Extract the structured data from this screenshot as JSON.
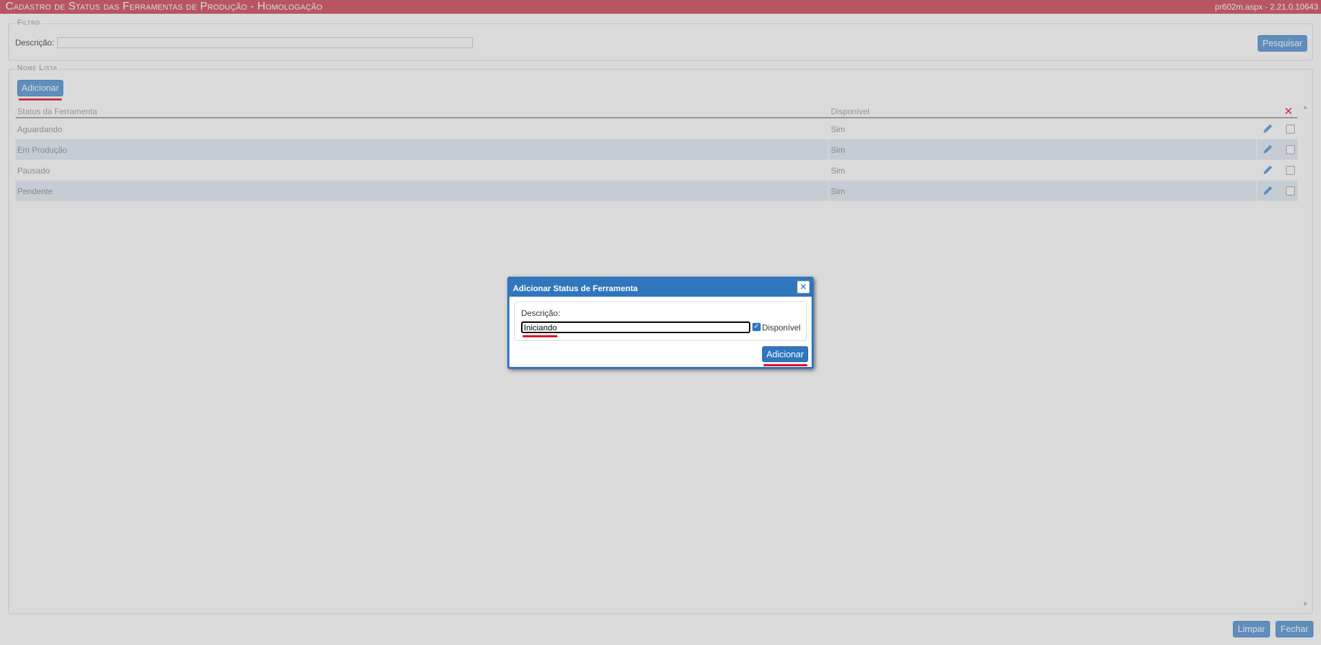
{
  "header": {
    "title": "Cadastro de Status das Ferramentas de Produção  - Homologação",
    "version": "pr602m.aspx - 2.21.0.10643"
  },
  "filtro": {
    "legend": "Filtro",
    "descricao_label": "Descrição:",
    "descricao_value": "",
    "pesquisar_label": "Pesquisar"
  },
  "lista": {
    "legend": "Nome Lista",
    "adicionar_label": "Adicionar",
    "columns": {
      "status": "Status da Ferramenta",
      "disponivel": "Disponível",
      "delete_icon": "x-icon"
    },
    "rows": [
      {
        "status": "Aguardando",
        "disponivel": "Sim",
        "checked": false
      },
      {
        "status": "Em Produção",
        "disponivel": "Sim",
        "checked": false
      },
      {
        "status": "Pausado",
        "disponivel": "Sim",
        "checked": false
      },
      {
        "status": "Pendente",
        "disponivel": "Sim",
        "checked": false
      }
    ]
  },
  "footer": {
    "limpar_label": "Limpar",
    "fechar_label": "Fechar"
  },
  "dialog": {
    "title": "Adicionar Status de Ferramenta",
    "close_glyph": "✕",
    "descricao_label": "Descrição:",
    "descricao_value": "Iniciando",
    "disponivel_label": "Disponível",
    "disponivel_checked": true,
    "adicionar_label": "Adicionar"
  },
  "colors": {
    "header": "#cc3d4f",
    "button": "#4a8fd4",
    "dialog_accent": "#2f76bd",
    "annotation_underline": "#e8081f"
  }
}
